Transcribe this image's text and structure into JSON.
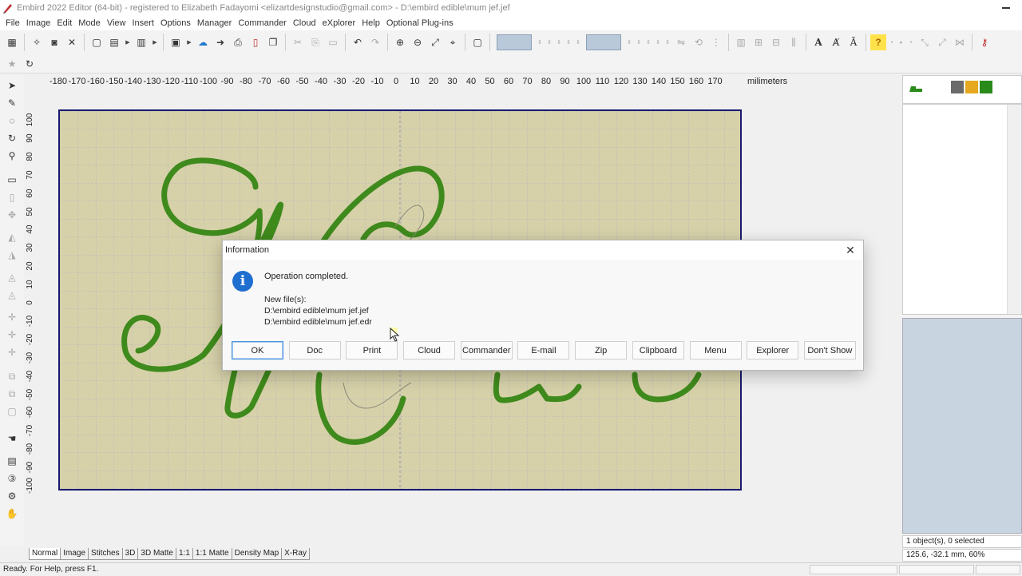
{
  "window": {
    "title": "Embird 2022 Editor (64-bit) - registered to Elizabeth Fadayomi <elizartdesignstudio@gmail.com> - D:\\embird edible\\mum jef.jef"
  },
  "menu": [
    "File",
    "Image",
    "Edit",
    "Mode",
    "View",
    "Insert",
    "Options",
    "Manager",
    "Commander",
    "Cloud",
    "eXplorer",
    "Help",
    "Optional Plug-ins"
  ],
  "ruler": {
    "top_ticks": [
      "-180",
      "-170",
      "-160",
      "-150",
      "-140",
      "-130",
      "-120",
      "-110",
      "-100",
      "-90",
      "-80",
      "-70",
      "-60",
      "-50",
      "-40",
      "-30",
      "-20",
      "-10",
      "0",
      "10",
      "20",
      "30",
      "40",
      "50",
      "60",
      "70",
      "80",
      "90",
      "100",
      "110",
      "120",
      "130",
      "140",
      "150",
      "160",
      "170"
    ],
    "left_ticks": [
      "100",
      "90",
      "80",
      "70",
      "60",
      "50",
      "40",
      "30",
      "20",
      "10",
      "0",
      "-10",
      "-20",
      "-30",
      "-40",
      "-50",
      "-60",
      "-70",
      "-80",
      "-90",
      "-100"
    ],
    "unit": "milimeters"
  },
  "colors": {
    "stitch": "#3f8a1c",
    "fabric": "#d6d1a9",
    "hoop_border": "#1a1a6e",
    "swatch_1": "#6a6a6a",
    "swatch_2": "#e6a81e",
    "swatch_3": "#2a8a1a"
  },
  "dialog": {
    "title": "Information",
    "message": "Operation completed.",
    "files_label": "New file(s):",
    "file_1": "D:\\embird edible\\mum jef.jef",
    "file_2": "D:\\embird edible\\mum jef.edr",
    "buttons": [
      "OK",
      "Doc",
      "Print",
      "Cloud",
      "Commander",
      "E-mail",
      "Zip",
      "Clipboard",
      "Menu",
      "Explorer",
      "Don't Show"
    ]
  },
  "view_tabs": [
    "Normal",
    "Image",
    "Stitches",
    "3D",
    "3D Matte",
    "1:1",
    "1:1 Matte",
    "Density Map",
    "X-Ray"
  ],
  "status": {
    "help": "Ready. For Help, press F1.",
    "objects": "1 object(s), 0 selected",
    "coords": "125.6, -32.1 mm, 60%"
  }
}
